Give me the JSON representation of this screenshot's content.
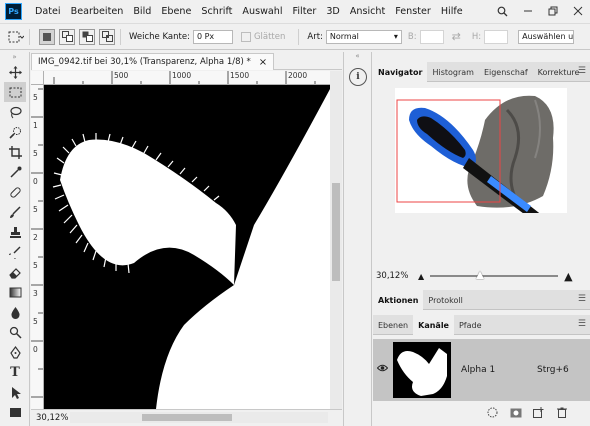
{
  "app": {
    "logo": "Ps"
  },
  "menu": [
    "Datei",
    "Bearbeiten",
    "Bild",
    "Ebene",
    "Schrift",
    "Auswahl",
    "Filter",
    "3D",
    "Ansicht",
    "Fenster",
    "Hilfe"
  ],
  "window_controls": [
    "search-icon",
    "minimize-icon",
    "restore-icon",
    "close-icon"
  ],
  "options": {
    "feather_label": "Weiche Kante:",
    "feather_value": "0 Px",
    "antialias_label": "Glätten",
    "style_label": "Art:",
    "style_value": "Normal",
    "width_label": "B:",
    "height_label": "H:",
    "select_mask_label": "Auswählen und"
  },
  "tools": [
    "move-icon",
    "marquee-icon",
    "lasso-icon",
    "quick-select-icon",
    "crop-icon",
    "eyedropper-icon",
    "healing-icon",
    "brush-icon",
    "stamp-icon",
    "history-brush-icon",
    "eraser-icon",
    "gradient-icon",
    "blur-icon",
    "dodge-icon",
    "pen-icon",
    "type-icon",
    "path-select-icon",
    "shape-icon"
  ],
  "document": {
    "tab_title": "IMG_0942.tif bei 30,1% (Transparenz, Alpha 1/8) *",
    "close_glyph": "×",
    "zoom": "30,12%",
    "ruler_top": [
      "500",
      "1000",
      "1500",
      "2000"
    ],
    "ruler_left": [
      "5",
      "1",
      "5",
      "0",
      "5",
      "2",
      "5",
      "3",
      "5",
      "0"
    ]
  },
  "dock": {
    "info_glyph": "i"
  },
  "panels": {
    "top_tabs": [
      "Navigator",
      "Histogram",
      "Eigenschaf",
      "Korrekture"
    ],
    "navigator_zoom": "30,12%",
    "mid_tabs": [
      "Aktionen",
      "Protokoll"
    ],
    "lower_tabs": [
      "Ebenen",
      "Kanäle",
      "Pfade"
    ],
    "channel": {
      "name": "Alpha 1",
      "shortcut": "Strg+6"
    },
    "bottom_icons": [
      "load-selection-icon",
      "save-selection-icon",
      "new-channel-icon",
      "delete-icon"
    ],
    "menu_glyph": "☰"
  },
  "colors": {
    "ps_logo_bg": "#001e36",
    "ps_logo_fg": "#31a8ff",
    "navigator_frame": "#ee4444",
    "brush_blue": "#1e5fd6",
    "towel_gray": "#6e6c68"
  }
}
